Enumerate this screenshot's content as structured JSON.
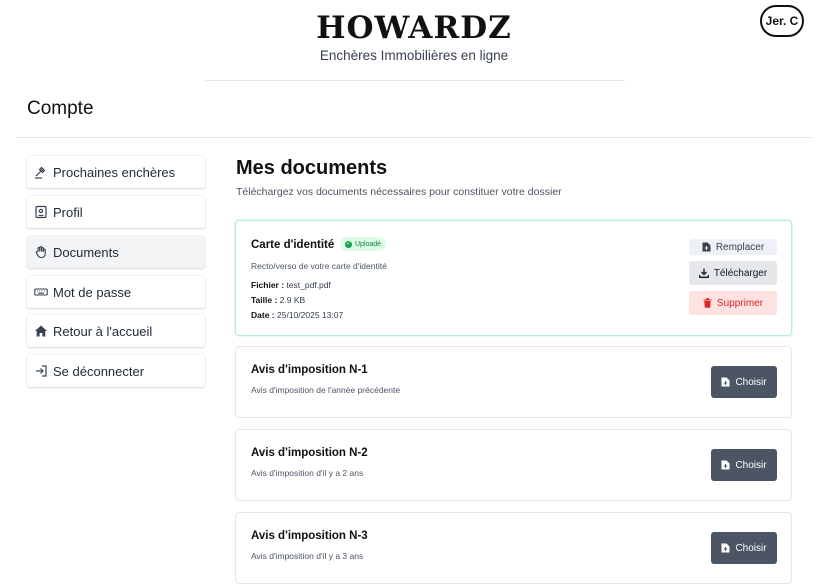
{
  "header": {
    "brand": "HOWARDZ",
    "tagline": "Enchères Immobilières en ligne",
    "user_initials": "Jer. C"
  },
  "page": {
    "title": "Compte"
  },
  "sidebar": {
    "items": [
      {
        "label": "Prochaines enchères",
        "icon": "gavel-icon"
      },
      {
        "label": "Profil",
        "icon": "id-card-icon"
      },
      {
        "label": "Documents",
        "icon": "hand-icon",
        "active": true
      },
      {
        "label": "Mot de passe",
        "icon": "keyboard-icon"
      },
      {
        "label": "Retour à l'accueil",
        "icon": "home-icon"
      },
      {
        "label": "Se déconnecter",
        "icon": "logout-icon"
      }
    ]
  },
  "main": {
    "title": "Mes documents",
    "subtitle": "Téléchargez vos documents nécessaires pour constituer votre dossier",
    "documents": [
      {
        "title": "Carte d'identité",
        "status": "Uploadé",
        "description": "Recto/verso de votre carte d'identité",
        "file_label": "Fichier :",
        "file_value": "test_pdf.pdf",
        "size_label": "Taille :",
        "size_value": "2.9 KB",
        "date_label": "Date :",
        "date_value": "25/10/2025 13:07",
        "replace_label": "Remplacer",
        "download_label": "Télécharger",
        "delete_label": "Supprimer"
      },
      {
        "title": "Avis d'imposition N-1",
        "description": "Avis d'imposition de l'année précédente",
        "choose_label": "Choisir"
      },
      {
        "title": "Avis d'imposition N-2",
        "description": "Avis d'imposition d'il y a 2 ans",
        "choose_label": "Choisir"
      },
      {
        "title": "Avis d'imposition N-3",
        "description": "Avis d'imposition d'il y a 3 ans",
        "choose_label": "Choisir"
      }
    ]
  },
  "colors": {
    "uploaded_border": "#b9ebe0",
    "badge_bg": "#dcfce7",
    "badge_text": "#15803d",
    "delete_text": "#dc2626",
    "choose_bg": "#4b5563"
  }
}
